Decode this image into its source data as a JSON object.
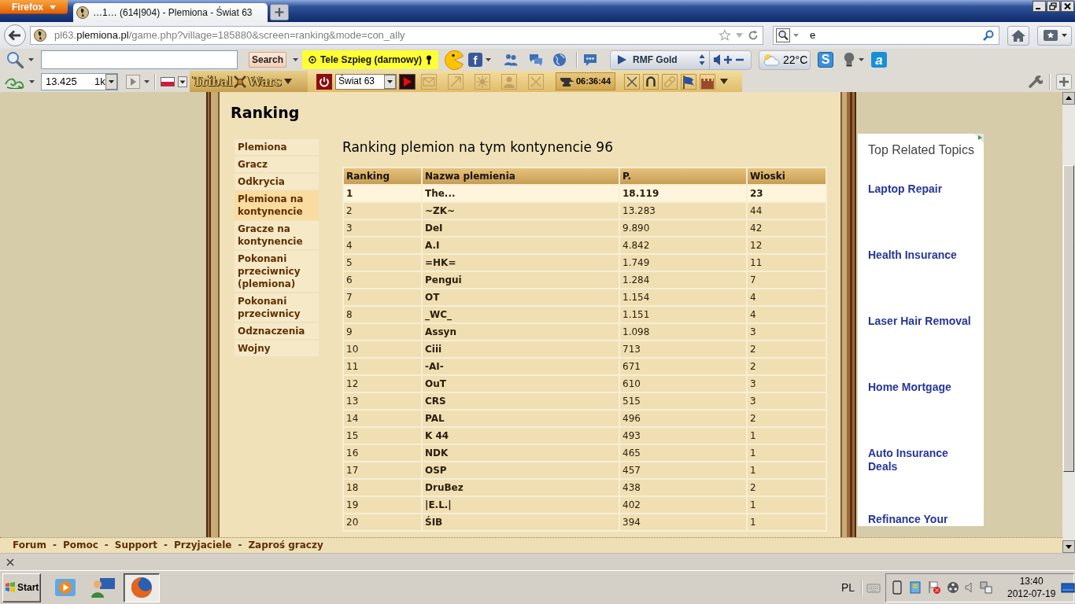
{
  "browser": {
    "menu_button": "Firefox",
    "tabs": [
      {
        "title": "…1… (614|904) - Plemiona - Świat 63",
        "selected": true
      }
    ],
    "url": {
      "subdomain": "pl63.",
      "domain": "plemiona.pl",
      "path": "/game.php?village=185880&screen=ranking&mode=con_ally"
    },
    "search_value": "e"
  },
  "toolbar": {
    "search_button": "Search",
    "promo": "Tele Szpieg (darmowy)",
    "letter_tiles": [
      "f",
      "S",
      "a"
    ],
    "radio_station": "RMF Gold",
    "temperature": "22°C"
  },
  "game_toolbar": {
    "amount": "13.425",
    "amount_unit": "1k",
    "logo": [
      "Tribal",
      "Wars"
    ],
    "world": "Świat 63",
    "timer": "06:36:44"
  },
  "page": {
    "title": "Ranking",
    "menu": [
      {
        "label": "Plemiona",
        "selected": false
      },
      {
        "label": "Gracz",
        "selected": false
      },
      {
        "label": "Odkrycia",
        "selected": false
      },
      {
        "label": "Plemiona na kontynencie",
        "selected": true
      },
      {
        "label": "Gracze na kontynencie",
        "selected": false
      },
      {
        "label": "Pokonani przeciwnicy (plemiona)",
        "selected": false
      },
      {
        "label": "Pokonani przeciwnicy",
        "selected": false
      },
      {
        "label": "Odznaczenia",
        "selected": false
      },
      {
        "label": "Wojny",
        "selected": false
      }
    ],
    "heading": "Ranking plemion na tym kontynencie 96",
    "table": {
      "columns": [
        "Ranking",
        "Nazwa plemienia",
        "P.",
        "Wioski"
      ],
      "rows": [
        {
          "rank": "1",
          "name": "The...",
          "points": "18.119",
          "villages": "23",
          "highlighted": true
        },
        {
          "rank": "2",
          "name": "~ZK~",
          "points": "13.283",
          "villages": "44",
          "highlighted": false
        },
        {
          "rank": "3",
          "name": "DeI",
          "points": "9.890",
          "villages": "42",
          "highlighted": false
        },
        {
          "rank": "4",
          "name": "A.I",
          "points": "4.842",
          "villages": "12",
          "highlighted": false
        },
        {
          "rank": "5",
          "name": "=HK=",
          "points": "1.749",
          "villages": "11",
          "highlighted": false
        },
        {
          "rank": "6",
          "name": "Pengui",
          "points": "1.284",
          "villages": "7",
          "highlighted": false
        },
        {
          "rank": "7",
          "name": "OT",
          "points": "1.154",
          "villages": "4",
          "highlighted": false
        },
        {
          "rank": "8",
          "name": "_WC_",
          "points": "1.151",
          "villages": "4",
          "highlighted": false
        },
        {
          "rank": "9",
          "name": "Assyn",
          "points": "1.098",
          "villages": "3",
          "highlighted": false
        },
        {
          "rank": "10",
          "name": "Ciii",
          "points": "713",
          "villages": "2",
          "highlighted": false
        },
        {
          "rank": "11",
          "name": "-AI-",
          "points": "671",
          "villages": "2",
          "highlighted": false
        },
        {
          "rank": "12",
          "name": "OuT",
          "points": "610",
          "villages": "3",
          "highlighted": false
        },
        {
          "rank": "13",
          "name": "CRS",
          "points": "515",
          "villages": "3",
          "highlighted": false
        },
        {
          "rank": "14",
          "name": "PAL",
          "points": "496",
          "villages": "2",
          "highlighted": false
        },
        {
          "rank": "15",
          "name": "K 44",
          "points": "493",
          "villages": "1",
          "highlighted": false
        },
        {
          "rank": "16",
          "name": "NDK",
          "points": "465",
          "villages": "1",
          "highlighted": false
        },
        {
          "rank": "17",
          "name": "OSP",
          "points": "457",
          "villages": "1",
          "highlighted": false
        },
        {
          "rank": "18",
          "name": "DruBez",
          "points": "438",
          "villages": "2",
          "highlighted": false
        },
        {
          "rank": "19",
          "name": "|E.L.|",
          "points": "402",
          "villages": "1",
          "highlighted": false
        },
        {
          "rank": "20",
          "name": "ŚIB",
          "points": "394",
          "villages": "1",
          "highlighted": false
        }
      ]
    }
  },
  "ad": {
    "title": "Top Related Topics",
    "links": [
      "Laptop Repair",
      "Health Insurance",
      "Laser Hair Removal",
      "Home Mortgage",
      "Auto Insurance Deals",
      "Refinance Your"
    ]
  },
  "footer": [
    {
      "kind": "link",
      "text": "Forum"
    },
    {
      "kind": "separator",
      "text": "-"
    },
    {
      "kind": "link",
      "text": "Pomoc"
    },
    {
      "kind": "separator",
      "text": "-"
    },
    {
      "kind": "link",
      "text": "Support"
    },
    {
      "kind": "separator",
      "text": "-"
    },
    {
      "kind": "link",
      "text": "Przyjaciele"
    },
    {
      "kind": "separator",
      "text": "-"
    },
    {
      "kind": "link",
      "text": "Zaproś graczy"
    }
  ],
  "taskbar": {
    "start": "Start",
    "apps": [
      {
        "selected": false
      },
      {
        "selected": false
      },
      {
        "selected": true
      }
    ],
    "language": "PL",
    "time": "13:40",
    "date": "2012-07-19"
  }
}
